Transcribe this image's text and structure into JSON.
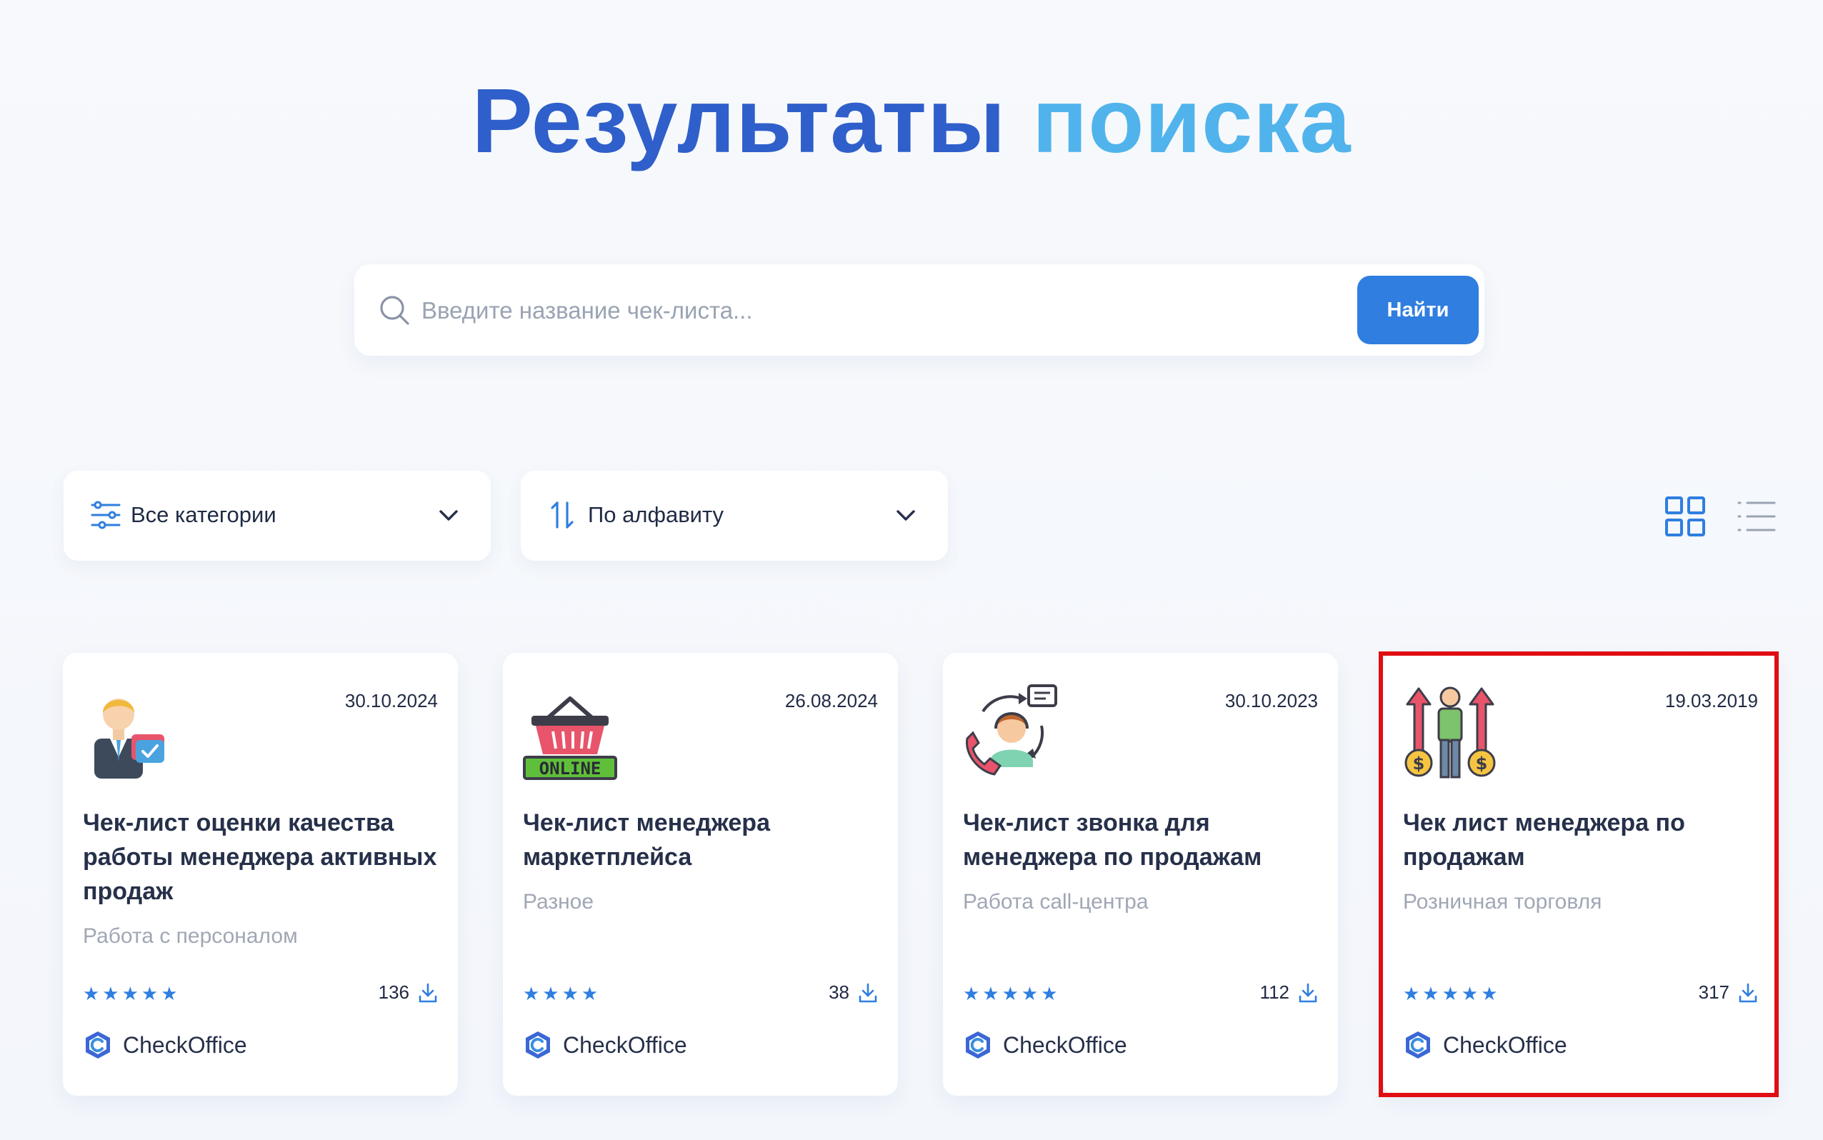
{
  "header": {
    "title_part1": "Результаты",
    "title_part2": "поиска",
    "title_color_1": "#2f5fca",
    "title_color_2": "#51b3ec"
  },
  "search": {
    "placeholder": "Введите название чек-листа...",
    "value": "",
    "button_label": "Найти",
    "button_color": "#2f7ee0",
    "icon": "search-icon"
  },
  "filters": {
    "category": {
      "label": "Все категории",
      "icon": "filter-sliders-icon"
    },
    "sort": {
      "label": "По алфавиту",
      "icon": "sort-arrows-icon"
    }
  },
  "view_toggle": {
    "grid_icon": "grid-view-icon",
    "list_icon": "list-view-icon",
    "active": "grid"
  },
  "cards": [
    {
      "image": "manager-checkmark-icon",
      "date": "30.10.2024",
      "title": "Чек-лист оценки качества работы менеджера активных продаж",
      "category": "Работа с персоналом",
      "rating_stars": "★★★★★",
      "rating": 5,
      "downloads": "136",
      "brand": "CheckOffice"
    },
    {
      "image": "online-basket-icon",
      "date": "26.08.2024",
      "title": "Чек-лист менеджера маркетплейса",
      "category": "Разное",
      "rating_stars": "★★★★",
      "rating": 4,
      "downloads": "38",
      "brand": "CheckOffice"
    },
    {
      "image": "call-center-operator-icon",
      "date": "30.10.2023",
      "title": "Чек-лист звонка для менеджера по продажам",
      "category": "Работа call-центра",
      "rating_stars": "★★★★★",
      "rating": 5,
      "downloads": "112",
      "brand": "CheckOffice"
    },
    {
      "image": "sales-growth-person-icon",
      "date": "19.03.2019",
      "title": "Чек лист менеджера по продажам",
      "category": "Розничная торговля",
      "rating_stars": "★★★★★",
      "rating": 5,
      "downloads": "317",
      "brand": "CheckOffice",
      "highlighted": true
    }
  ],
  "colors": {
    "accent": "#2f7ee0",
    "highlight": "#e00d12",
    "muted_text": "#a0a7b4"
  }
}
